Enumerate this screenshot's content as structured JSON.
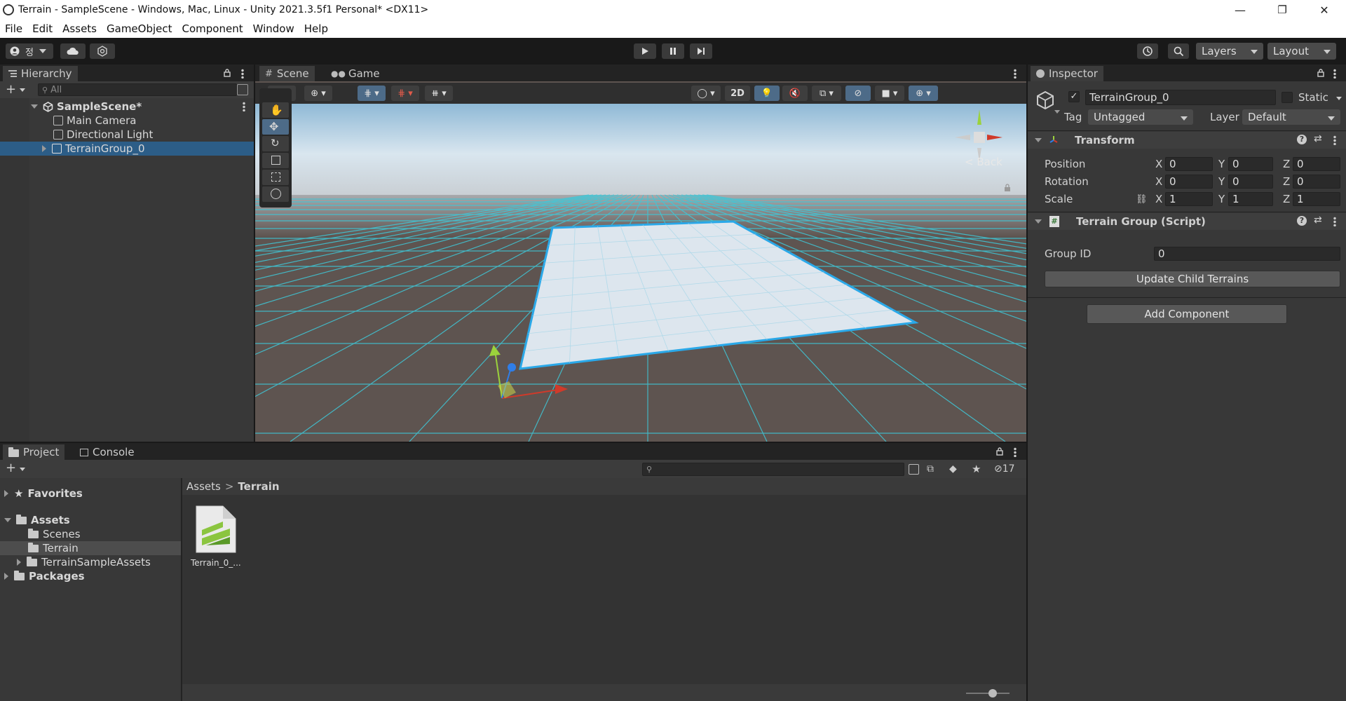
{
  "window": {
    "title": "Terrain - SampleScene - Windows, Mac, Linux - Unity 2021.3.5f1 Personal* <DX11>",
    "minimize": "—",
    "maximize": "❐",
    "close": "✕"
  },
  "menu": [
    "File",
    "Edit",
    "Assets",
    "GameObject",
    "Component",
    "Window",
    "Help"
  ],
  "toolbar": {
    "account_label": "정",
    "layers_label": "Layers",
    "layout_label": "Layout"
  },
  "hierarchy": {
    "tab_label": "Hierarchy",
    "search_placeholder": "All",
    "items": [
      {
        "label": "SampleScene*"
      },
      {
        "label": "Main Camera"
      },
      {
        "label": "Directional Light"
      },
      {
        "label": "TerrainGroup_0"
      }
    ]
  },
  "scene": {
    "tabs": [
      {
        "label": "Scene"
      },
      {
        "label": "Game"
      }
    ],
    "mode_2d": "2D",
    "gizmo_back": "Back",
    "colors": {
      "sky_top": "#9fc6de",
      "ground": "#5e5450",
      "grid": "#3fc8d8",
      "terrain": "#dde6ee",
      "terrain_edge": "#2aa8e8"
    }
  },
  "inspector": {
    "tab_label": "Inspector",
    "object_name": "TerrainGroup_0",
    "static_label": "Static",
    "tag_label": "Tag",
    "tag_value": "Untagged",
    "layer_label": "Layer",
    "layer_value": "Default",
    "transform": {
      "title": "Transform",
      "position": {
        "label": "Position",
        "x": "0",
        "y": "0",
        "z": "0"
      },
      "rotation": {
        "label": "Rotation",
        "x": "0",
        "y": "0",
        "z": "0"
      },
      "scale": {
        "label": "Scale",
        "x": "1",
        "y": "1",
        "z": "1"
      },
      "axis_x": "X",
      "axis_y": "Y",
      "axis_z": "Z"
    },
    "script": {
      "title": "Terrain Group (Script)",
      "group_id_label": "Group ID",
      "group_id_value": "0",
      "update_button": "Update Child Terrains"
    },
    "add_component": "Add Component"
  },
  "project": {
    "tabs": [
      {
        "label": "Project"
      },
      {
        "label": "Console"
      }
    ],
    "hidden_count": "17",
    "tree": {
      "favorites": "Favorites",
      "assets": "Assets",
      "scenes": "Scenes",
      "terrain": "Terrain",
      "terrain_sample_assets": "TerrainSampleAssets",
      "packages": "Packages"
    },
    "breadcrumb": {
      "root": "Assets",
      "sep": ">",
      "current": "Terrain"
    },
    "asset_label": "Terrain_0_..."
  }
}
